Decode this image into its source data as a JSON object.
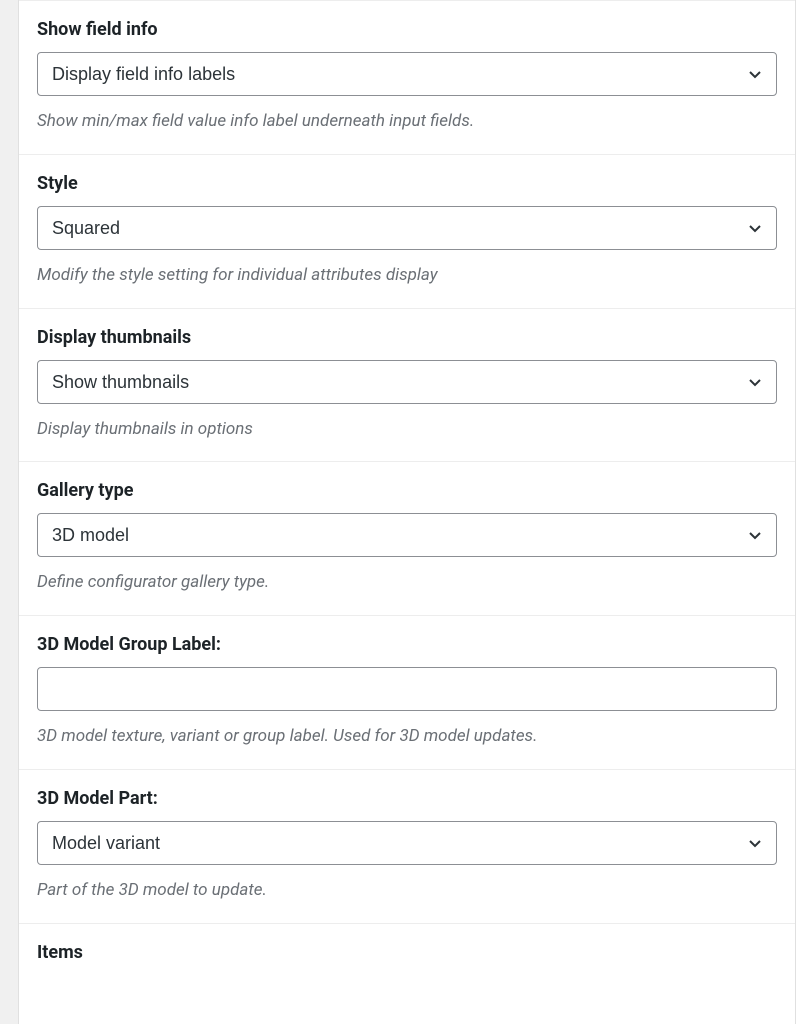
{
  "fields": {
    "showFieldInfo": {
      "label": "Show field info",
      "value": "Display field info labels",
      "help": "Show min/max field value info label underneath input fields."
    },
    "style": {
      "label": "Style",
      "value": "Squared",
      "help": "Modify the style setting for individual attributes display"
    },
    "displayThumbnails": {
      "label": "Display thumbnails",
      "value": "Show thumbnails",
      "help": "Display thumbnails in options"
    },
    "galleryType": {
      "label": "Gallery type",
      "value": "3D model",
      "help": "Define configurator gallery type."
    },
    "modelGroupLabel": {
      "label": "3D Model Group Label:",
      "value": "",
      "help": "3D model texture, variant or group label. Used for 3D model updates."
    },
    "modelPart": {
      "label": "3D Model Part:",
      "value": "Model variant",
      "help": "Part of the 3D model to update."
    },
    "items": {
      "label": "Items"
    }
  }
}
